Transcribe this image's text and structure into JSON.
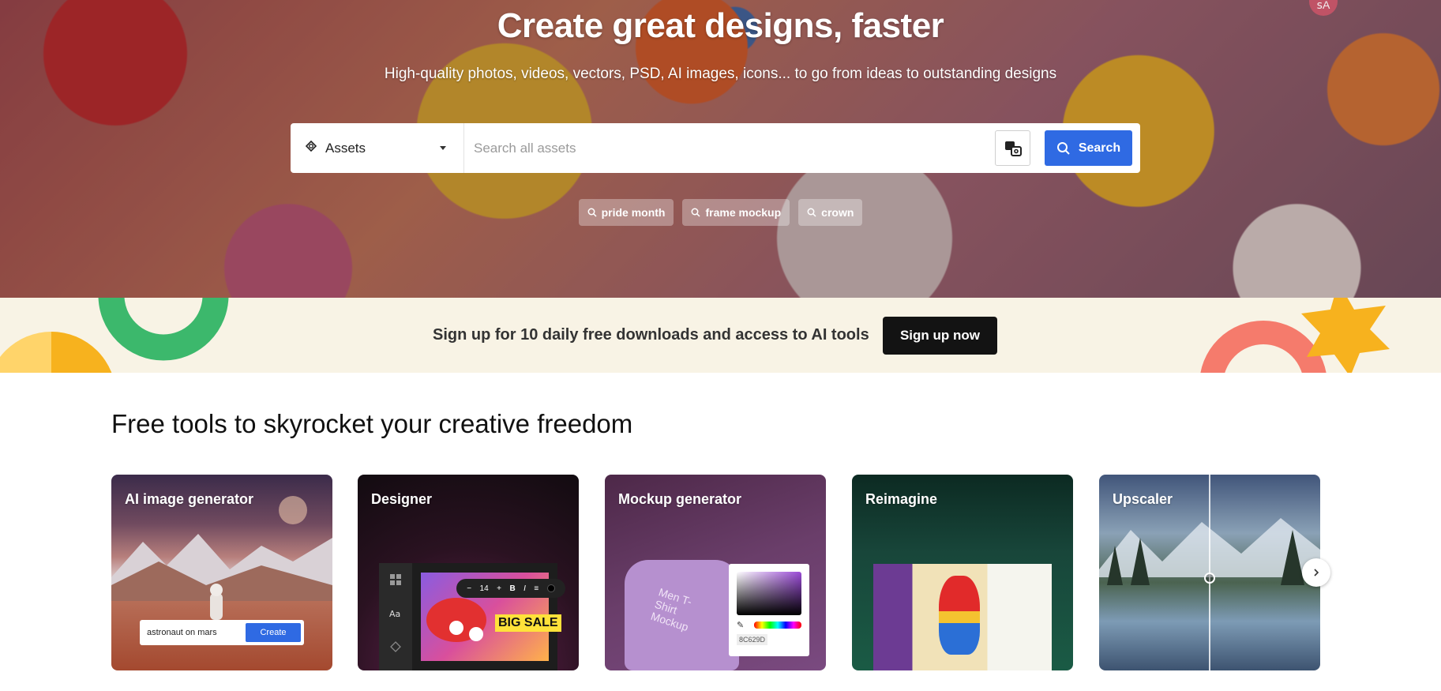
{
  "hero": {
    "title": "Create great designs, faster",
    "subtitle": "High-quality photos, videos, vectors, PSD, AI images, icons... to go from ideas to outstanding designs",
    "avatar_text": "ꜱA"
  },
  "search": {
    "asset_type": "Assets",
    "placeholder": "Search all assets",
    "button_label": "Search",
    "tags": [
      "pride month",
      "frame mockup",
      "crown"
    ]
  },
  "banner": {
    "text": "Sign up for 10 daily free downloads and access to AI tools",
    "button_label": "Sign up now"
  },
  "tools": {
    "title": "Free tools to skyrocket your creative freedom",
    "cards": [
      {
        "title": "AI image generator",
        "prompt": "astronaut on mars",
        "button": "Create"
      },
      {
        "title": "Designer",
        "font_size": "14",
        "sale_text": "BIG SALE"
      },
      {
        "title": "Mockup generator",
        "shirt_text": "Men T-Shirt Mockup",
        "hex": "8C629D"
      },
      {
        "title": "Reimagine"
      },
      {
        "title": "Upscaler"
      }
    ]
  },
  "colors": {
    "accent": "#2f6ae3",
    "banner_bg": "#f8f3e5",
    "banner_button": "#131313"
  }
}
